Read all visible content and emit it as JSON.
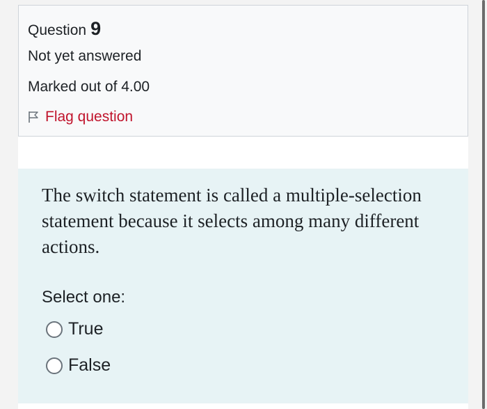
{
  "question_info": {
    "label": "Question",
    "number": "9",
    "state": "Not yet answered",
    "grade": "Marked out of 4.00",
    "flag_label": "Flag question",
    "flag_icon": "flag-outline-icon"
  },
  "question": {
    "text": "The switch statement is called a multiple-selection statement because it selects among many different actions.",
    "prompt": "Select one:",
    "options": [
      {
        "label": "True",
        "selected": false
      },
      {
        "label": "False",
        "selected": false
      }
    ]
  },
  "colors": {
    "flag_link": "#c0142c",
    "content_background": "#e7f3f5",
    "info_background": "#f8f9fa"
  }
}
